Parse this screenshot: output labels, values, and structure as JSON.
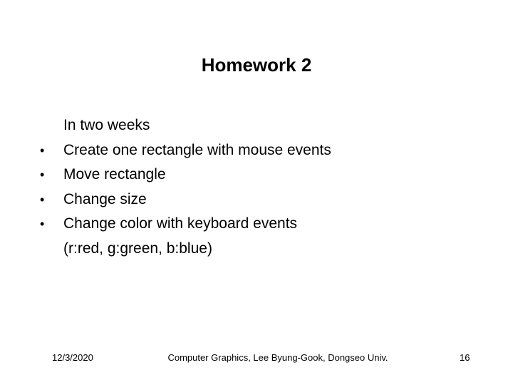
{
  "slide": {
    "title": "Homework 2",
    "items": [
      {
        "text": "In two weeks",
        "bullet": ""
      },
      {
        "text": "Create one rectangle with mouse events",
        "bullet": "•"
      },
      {
        "text": "Move rectangle",
        "bullet": "•"
      },
      {
        "text": "Change size",
        "bullet": "•"
      },
      {
        "text": "Change color with keyboard events",
        "bullet": "•"
      },
      {
        "text": "(r:red, g:green, b:blue)",
        "bullet": ""
      }
    ]
  },
  "footer": {
    "date": "12/3/2020",
    "center": "Computer Graphics, Lee Byung-Gook, Dongseo Univ.",
    "page": "16"
  }
}
